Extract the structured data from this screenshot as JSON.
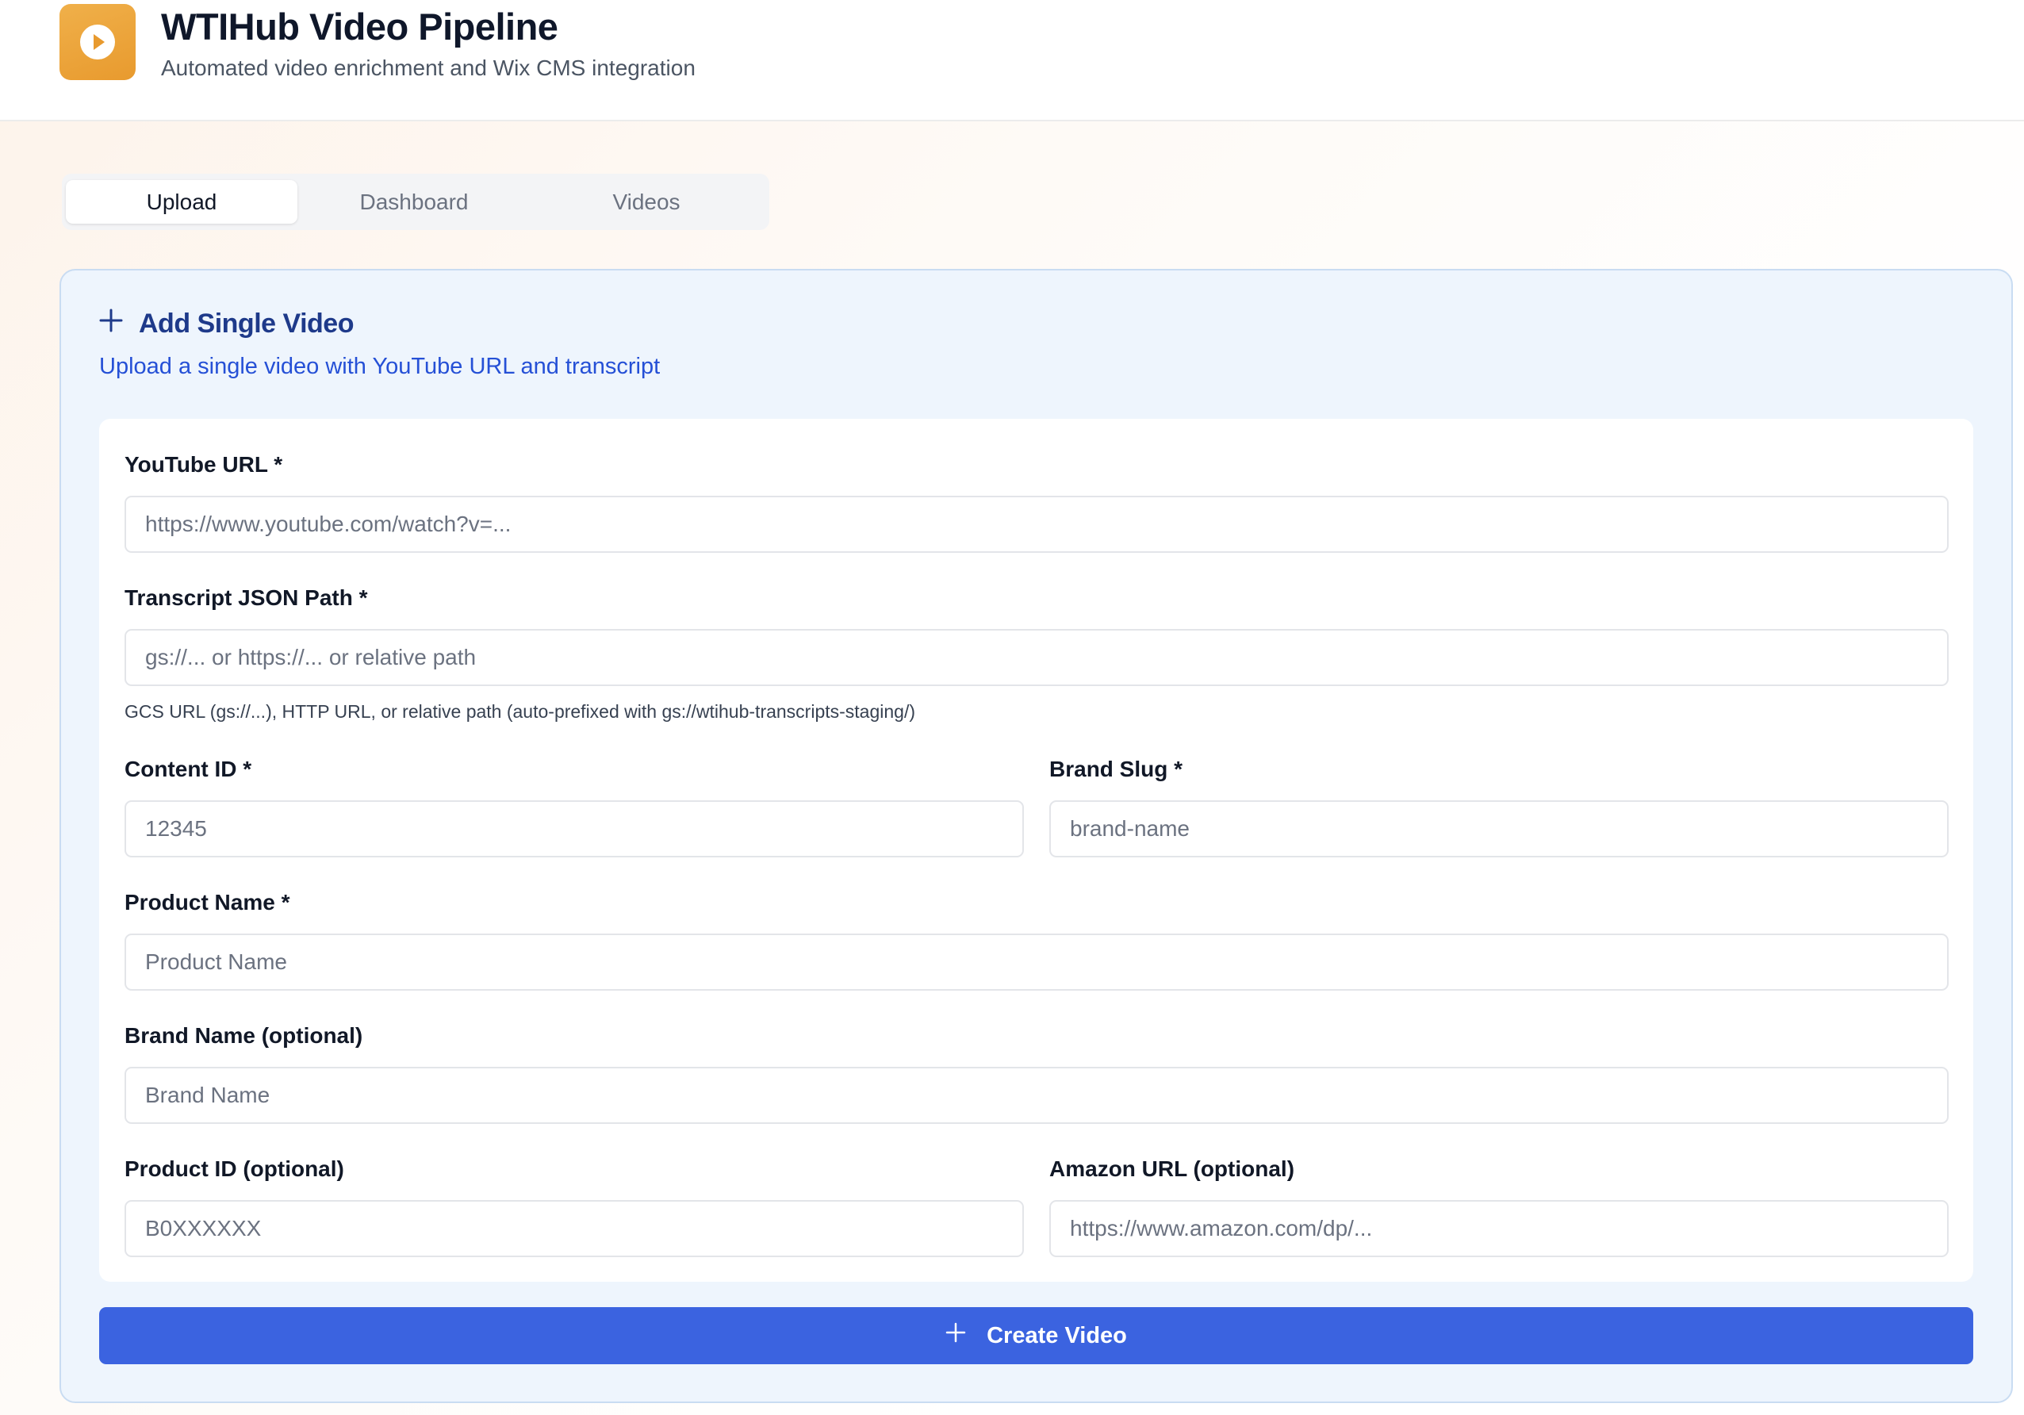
{
  "header": {
    "title": "WTIHub Video Pipeline",
    "subtitle": "Automated video enrichment and Wix CMS integration",
    "logo_icon": "play-circle-icon",
    "brand_color": "#e89a2e"
  },
  "tabs": [
    {
      "label": "Upload",
      "active": true
    },
    {
      "label": "Dashboard",
      "active": false
    },
    {
      "label": "Videos",
      "active": false
    }
  ],
  "card": {
    "title": "Add Single Video",
    "title_icon": "plus-icon",
    "description": "Upload a single video with YouTube URL and transcript"
  },
  "form": {
    "youtube_url": {
      "label": "YouTube URL *",
      "placeholder": "https://www.youtube.com/watch?v=...",
      "value": ""
    },
    "transcript_path": {
      "label": "Transcript JSON Path *",
      "placeholder": "gs://... or https://... or relative path",
      "value": "",
      "hint": "GCS URL (gs://...), HTTP URL, or relative path (auto-prefixed with gs://wtihub-transcripts-staging/)"
    },
    "content_id": {
      "label": "Content ID *",
      "placeholder": "12345",
      "value": ""
    },
    "brand_slug": {
      "label": "Brand Slug *",
      "placeholder": "brand-name",
      "value": ""
    },
    "product_name": {
      "label": "Product Name *",
      "placeholder": "Product Name",
      "value": ""
    },
    "brand_name": {
      "label": "Brand Name (optional)",
      "placeholder": "Brand Name",
      "value": ""
    },
    "product_id": {
      "label": "Product ID (optional)",
      "placeholder": "B0XXXXXX",
      "value": ""
    },
    "amazon_url": {
      "label": "Amazon URL (optional)",
      "placeholder": "https://www.amazon.com/dp/...",
      "value": ""
    }
  },
  "submit": {
    "label": "Create Video",
    "icon": "plus-icon",
    "color": "#3b63e0"
  }
}
